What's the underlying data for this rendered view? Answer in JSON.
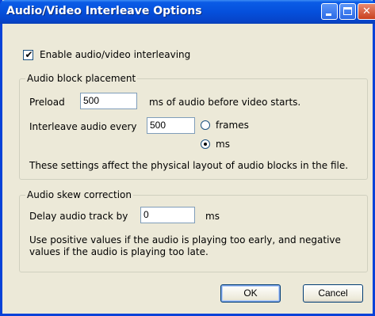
{
  "window": {
    "title": "Audio/Video Interleave Options"
  },
  "enable": {
    "label": "Enable audio/video interleaving",
    "checked": true
  },
  "placement": {
    "title": "Audio block placement",
    "preload_label": "Preload",
    "preload_value": "500",
    "preload_suffix": "ms of audio before video starts.",
    "interleave_label": "Interleave audio every",
    "interleave_value": "500",
    "radio_frames": "frames",
    "radio_ms": "ms",
    "selected_unit": "ms",
    "note": "These settings affect the physical layout of audio blocks in the file."
  },
  "skew": {
    "title": "Audio skew correction",
    "delay_label": "Delay audio track by",
    "delay_value": "0",
    "delay_suffix": "ms",
    "note_line1": "Use positive values if the audio is playing too early, and negative",
    "note_line2": "values if the audio is playing too late."
  },
  "buttons": {
    "ok": "OK",
    "cancel": "Cancel"
  },
  "icons": {
    "check": "✔",
    "close": "✕"
  }
}
